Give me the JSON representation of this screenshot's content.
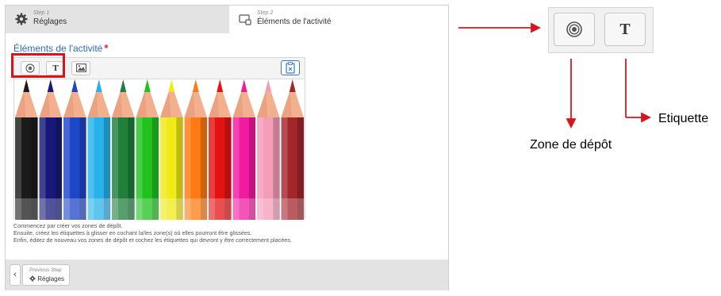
{
  "wizard": {
    "step1": {
      "small": "Step 1",
      "title": "Réglages",
      "icon": "gear-icon"
    },
    "step2": {
      "small": "Step 2",
      "title": "Éléments de l'activité",
      "icon": "monitor-icon"
    }
  },
  "section": {
    "title": "Éléments de l'activité",
    "required_mark": "*"
  },
  "toolbar": {
    "dropzone_icon": "target-icon",
    "label_button": "T",
    "image_icon": "image-icon",
    "right_icon": "clipboard-icon"
  },
  "canvas": {
    "image": "colored-pencils",
    "pencil_colors": [
      "#1b1b1b",
      "#17197a",
      "#1e46c8",
      "#27b2e9",
      "#1f7f3b",
      "#21c11e",
      "#f0ea17",
      "#ff7a12",
      "#e41313",
      "#f21aa0",
      "#f49cb8",
      "#a3262b"
    ]
  },
  "instructions": [
    "Commencez par créer vos zones de dépôt.",
    "Ensuite, créez les étiquettes à glisser en cochant la/les zone(s) où elles pourront être glissées.",
    "Enfin, éditez de nouveau vos zones de dépôt et cochez les étiquettes qui devront y être correctement placées."
  ],
  "footer": {
    "back_symbol": "‹",
    "prev_small": "Previous Step",
    "prev_label": "Réglages",
    "prev_icon": "gear-icon"
  },
  "zoom": {
    "label_button": "T"
  },
  "annotations": {
    "zone_label": "Zone de dépôt",
    "etiquette_label": "Etiquette",
    "accent": "#d9141d"
  }
}
